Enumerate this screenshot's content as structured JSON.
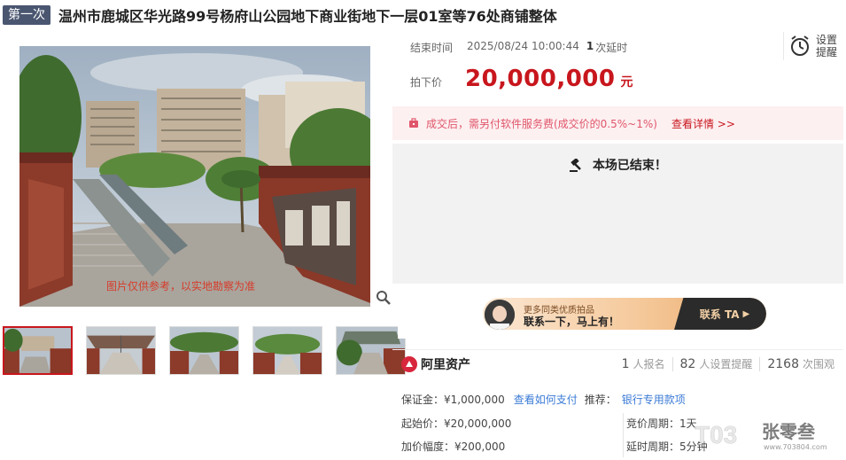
{
  "title": {
    "round_badge": "第一次",
    "text": "温州市鹿城区华光路99号杨府山公园地下商业街地下一层01室等76处商铺整体"
  },
  "gallery": {
    "caption": "图片仅供参考，以实地勘察为准",
    "thumbnail_count": 5,
    "selected_index": 0
  },
  "status": {
    "end_label": "结束时间",
    "end_time": "2025/08/24 10:00:44",
    "delay_count": "1",
    "delay_suffix": "次延时",
    "reminder_label": "设置提醒"
  },
  "price": {
    "label": "拍下价",
    "value": "20,000,000",
    "unit": "元"
  },
  "fee_notice": {
    "text": "成交后，需另付软件服务费(成交价的0.5%~1%)",
    "link": "查看详情 >>"
  },
  "ended_text": "本场已结束！",
  "promo": {
    "line1": "更多同类优质拍品",
    "line2": "联系一下，马上有！",
    "cta": "联系 TA"
  },
  "stats": {
    "brand": "阿里资产",
    "registrants": "1",
    "registrants_label": "人报名",
    "reminders": "82",
    "reminders_label": "人设置提醒",
    "views": "2168",
    "views_label": "次围观"
  },
  "details": {
    "deposit": "保证金：¥1,000,000",
    "deposit_link": "查看如何支付",
    "recommend_label": "推荐：",
    "recommend_link": "银行专用款项",
    "start_price": "起始价：¥20,000,000",
    "increment": "加价幅度：¥200,000",
    "bid_period": "竞价周期：1天",
    "delay_period": "延时周期：5分钟"
  },
  "colors": {
    "accent_red": "#c8161d",
    "badge_bg": "#4a5670",
    "link_blue": "#3b7bd6",
    "fee_bg": "#fdf0f1"
  }
}
